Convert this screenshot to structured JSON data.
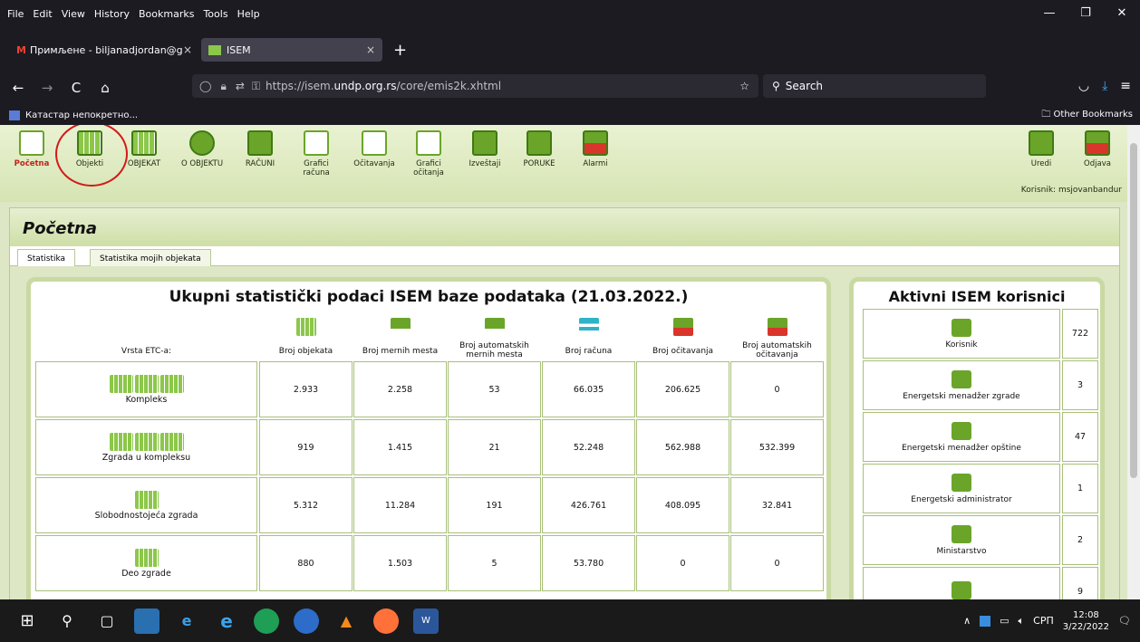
{
  "browser": {
    "menu": [
      "File",
      "Edit",
      "View",
      "History",
      "Bookmarks",
      "Tools",
      "Help"
    ],
    "window_controls": [
      "—",
      "❐",
      "✕"
    ],
    "tabs": [
      {
        "title": "Примљене - biljanadjordan@g",
        "icon": "gmail-icon"
      },
      {
        "title": "ISEM",
        "icon": "isem-icon"
      }
    ],
    "tab_close": "×",
    "new_tab": "+",
    "url_prefix": "https://isem.",
    "url_host": "undp.org.rs",
    "url_path": "/core/emis2k.xhtml",
    "search_placeholder": "Search",
    "bookmark_left": "Катастар непокретно...",
    "bookmark_right": "Other Bookmarks"
  },
  "app": {
    "toolbar": [
      {
        "label": "Početna",
        "icon": "home-icon"
      },
      {
        "label": "Objekti",
        "icon": "objects-grid-icon"
      },
      {
        "label": "OBJEKAT",
        "icon": "building-icon"
      },
      {
        "label": "O OBJEKTU",
        "icon": "globe-icon"
      },
      {
        "label": "RAČUNI",
        "icon": "bills-icon"
      },
      {
        "label": "Grafici računa",
        "icon": "bills-chart-icon"
      },
      {
        "label": "Očitavanja",
        "icon": "readings-icon"
      },
      {
        "label": "Grafici očitanja",
        "icon": "readings-chart-icon"
      },
      {
        "label": "Izveštaji",
        "icon": "reports-icon"
      },
      {
        "label": "PORUKE",
        "icon": "messages-icon"
      },
      {
        "label": "Alarmi",
        "icon": "alarm-icon"
      }
    ],
    "right_buttons": [
      {
        "label": "Uredi",
        "icon": "edit-icon"
      },
      {
        "label": "Odjava",
        "icon": "logout-icon"
      }
    ],
    "user_label": "Korisnik: msjovanbandur",
    "page_title": "Početna",
    "tabs": [
      "Statistika",
      "Statistika mojih objekata"
    ],
    "stats": {
      "title": "Ukupni statistički podaci ISEM baze podataka (21.03.2022.)",
      "first_header": "Vrsta ETC-a:",
      "headers": [
        "Broj objekata",
        "Broj mernih mesta",
        "Broj automatskih mernih mesta",
        "Broj računa",
        "Broj očitavanja",
        "Broj automatskih očitavanja"
      ],
      "rows": [
        {
          "name": "Kompleks",
          "values": [
            "2.933",
            "2.258",
            "53",
            "66.035",
            "206.625",
            "0"
          ]
        },
        {
          "name": "Zgrada u kompleksu",
          "values": [
            "919",
            "1.415",
            "21",
            "52.248",
            "562.988",
            "532.399"
          ]
        },
        {
          "name": "Slobodnostojeća zgrada",
          "values": [
            "5.312",
            "11.284",
            "191",
            "426.761",
            "408.095",
            "32.841"
          ]
        },
        {
          "name": "Deo zgrade",
          "values": [
            "880",
            "1.503",
            "5",
            "53.780",
            "0",
            "0"
          ]
        }
      ]
    },
    "users": {
      "title": "Aktivni ISEM korisnici",
      "rows": [
        {
          "role": "Korisnik",
          "count": "722"
        },
        {
          "role": "Energetski menadžer zgrade",
          "count": "3"
        },
        {
          "role": "Energetski menadžer opštine",
          "count": "47"
        },
        {
          "role": "Energetski administrator",
          "count": "1"
        },
        {
          "role": "Ministarstvo",
          "count": "2"
        },
        {
          "role": "",
          "count": "9"
        }
      ]
    }
  },
  "taskbar": {
    "lang": "СРП",
    "time": "12:08",
    "date": "3/22/2022"
  }
}
